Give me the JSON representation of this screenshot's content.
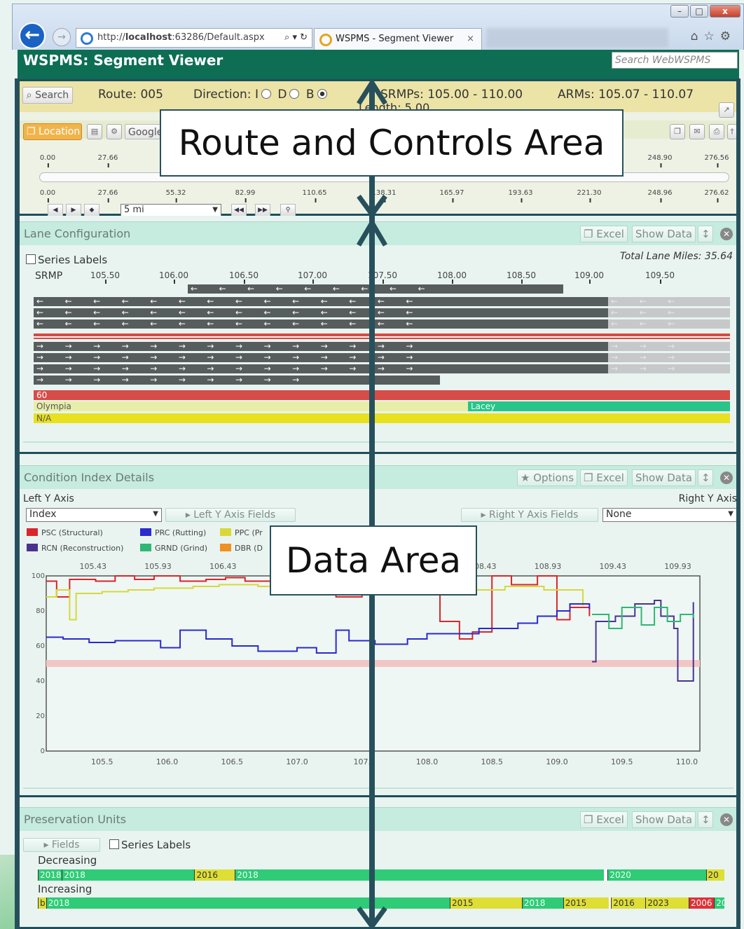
{
  "browser": {
    "url_prefix": "http://",
    "url_host": "localhost",
    "url_rest": ":63286/Default.aspx",
    "address_actions": "⌕ ▾ ↻",
    "tab_title": "WSPMS - Segment Viewer",
    "tab_close": "×",
    "window_min": "–",
    "window_max": "□",
    "window_close": "x",
    "toolbar_icons": "⌂☆⚙"
  },
  "app": {
    "title": "WSPMS: Segment Viewer",
    "search_placeholder": "Search WebWSPMS"
  },
  "route_panel": {
    "search_label": "⌕ Search",
    "route": "Route: 005",
    "direction_label": "Direction:",
    "direction_options": [
      "I",
      "D",
      "B"
    ],
    "direction_selected": "B",
    "srmps": "SRMPs: 105.00 - 110.00",
    "arms": "ARMs: 105.07 - 110.07",
    "length": "Length: 5.00",
    "location_button": "❐ Location",
    "google_button": "Google",
    "upper_scale": [
      "0.00",
      "27.66",
      "248.90",
      "276.56"
    ],
    "lower_scale": [
      "0.00",
      "27.66",
      "55.32",
      "82.99",
      "110.65",
      "138.31",
      "165.97",
      "193.63",
      "221.30",
      "248.96",
      "276.62"
    ],
    "zoom_select": "5 mi"
  },
  "lane_panel": {
    "title": "Lane Configuration",
    "excel": "❐ Excel",
    "show_data": "Show Data",
    "series_labels": "Series Labels",
    "total_lane_miles": "Total Lane Miles: 35.64",
    "srmp_label": "SRMP",
    "srmp_ticks": [
      "105.50",
      "106.00",
      "106.50",
      "107.00",
      "107.50",
      "108.00",
      "108.50",
      "109.00",
      "109.50"
    ],
    "speed_value": "60",
    "city_left": "Olympia",
    "city_right": "Lacey",
    "na_label": "N/A",
    "left_arrow": "←",
    "right_arrow": "→"
  },
  "condition_panel": {
    "title": "Condition Index Details",
    "options": "★ Options",
    "excel": "❐ Excel",
    "show_data": "Show Data",
    "left_axis_label": "Left Y Axis",
    "right_axis_label": "Right Y Axis",
    "left_select": "Index",
    "left_fields": "▸ Left Y Axis Fields",
    "right_fields": "▸ Right Y Axis Fields",
    "right_select": "None",
    "legend": [
      {
        "name": "PSC (Structural)",
        "color": "#d9262a"
      },
      {
        "name": "PRC (Rutting)",
        "color": "#2a2ad0"
      },
      {
        "name": "PPC (Pr",
        "color": "#d8d838"
      },
      {
        "name": "RCN (Reconstruction)",
        "color": "#4a3390"
      },
      {
        "name": "GRND (Grind)",
        "color": "#2fb774"
      },
      {
        "name": "DBR (D",
        "color": "#f09020"
      }
    ]
  },
  "chart_data": {
    "type": "line",
    "top_axis_ticks": [
      "105.43",
      "105.93",
      "106.43",
      "108.43",
      "108.93",
      "109.43",
      "109.93"
    ],
    "x_ticks": [
      "105.5",
      "106.0",
      "106.5",
      "107.0",
      "107.",
      "108.0",
      "108.5",
      "109.0",
      "109.5",
      "110.0"
    ],
    "y_ticks": [
      "100",
      "80",
      "60",
      "40",
      "20",
      "0"
    ],
    "ylim": [
      0,
      100
    ],
    "xlim": [
      105.07,
      110.1
    ],
    "threshold_band": [
      48,
      52
    ],
    "series": [
      {
        "color": "#d9262a",
        "values": [
          [
            105.07,
            97
          ],
          [
            105.15,
            88
          ],
          [
            105.25,
            98
          ],
          [
            105.45,
            97
          ],
          [
            105.6,
            100
          ],
          [
            105.75,
            98
          ],
          [
            105.9,
            100
          ],
          [
            106.1,
            97
          ],
          [
            106.3,
            98
          ],
          [
            106.45,
            99
          ],
          [
            106.6,
            97
          ],
          [
            107.3,
            88
          ],
          [
            107.5,
            92
          ],
          [
            107.62,
            98
          ],
          [
            108.0,
            97
          ],
          [
            108.1,
            74
          ],
          [
            108.25,
            64
          ],
          [
            108.35,
            68
          ],
          [
            108.5,
            100
          ],
          [
            108.65,
            95
          ],
          [
            108.85,
            100
          ],
          [
            109.0,
            75
          ],
          [
            109.1,
            82
          ],
          [
            109.25,
            77
          ]
        ]
      },
      {
        "color": "#d8d838",
        "values": [
          [
            105.07,
            88
          ],
          [
            105.15,
            92
          ],
          [
            105.25,
            75
          ],
          [
            105.3,
            90
          ],
          [
            105.5,
            91
          ],
          [
            105.7,
            92
          ],
          [
            105.9,
            93
          ],
          [
            106.2,
            94
          ],
          [
            106.4,
            95
          ],
          [
            106.7,
            94
          ],
          [
            107.0,
            96
          ],
          [
            107.3,
            93
          ],
          [
            107.6,
            95
          ],
          [
            108.2,
            92
          ],
          [
            108.6,
            94
          ],
          [
            108.9,
            92
          ],
          [
            109.2,
            83
          ]
        ]
      },
      {
        "color": "#2a2ad0",
        "values": [
          [
            105.07,
            65
          ],
          [
            105.2,
            64
          ],
          [
            105.4,
            62
          ],
          [
            105.6,
            63
          ],
          [
            105.95,
            59
          ],
          [
            106.1,
            69
          ],
          [
            106.3,
            64
          ],
          [
            106.5,
            60
          ],
          [
            106.7,
            57
          ],
          [
            107.0,
            59
          ],
          [
            107.15,
            56
          ],
          [
            107.3,
            69
          ],
          [
            107.4,
            63
          ],
          [
            107.6,
            61
          ],
          [
            107.85,
            64
          ],
          [
            108.0,
            67
          ],
          [
            108.4,
            70
          ],
          [
            108.7,
            73
          ],
          [
            108.85,
            77
          ],
          [
            109.0,
            80
          ],
          [
            109.1,
            84
          ],
          [
            109.25,
            81
          ]
        ]
      },
      {
        "color": "#4a3390",
        "values": [
          [
            109.27,
            51
          ],
          [
            109.3,
            74
          ],
          [
            109.45,
            77
          ],
          [
            109.6,
            84
          ],
          [
            109.75,
            86
          ],
          [
            109.8,
            77
          ],
          [
            109.9,
            70
          ],
          [
            109.93,
            40
          ],
          [
            110.05,
            85
          ]
        ]
      },
      {
        "color": "#2fb774",
        "values": [
          [
            109.27,
            78
          ],
          [
            109.4,
            70
          ],
          [
            109.5,
            82
          ],
          [
            109.65,
            72
          ],
          [
            109.75,
            82
          ],
          [
            109.85,
            74
          ],
          [
            109.95,
            78
          ],
          [
            110.05,
            76
          ]
        ]
      }
    ]
  },
  "preservation_panel": {
    "title": "Preservation Units",
    "excel": "❐ Excel",
    "show_data": "Show Data",
    "fields": "▸ Fields",
    "series_labels": "Series Labels",
    "decreasing_label": "Decreasing",
    "increasing_label": "Increasing",
    "decreasing": [
      {
        "label": "2018",
        "start": 0.0,
        "end": 0.035,
        "color": "#2fcb77"
      },
      {
        "label": "2018",
        "start": 0.035,
        "end": 0.228,
        "color": "#2fcb77"
      },
      {
        "label": "2016",
        "start": 0.228,
        "end": 0.287,
        "color": "#dede35"
      },
      {
        "label": "2018",
        "start": 0.287,
        "end": 0.825,
        "color": "#2fcb77"
      },
      {
        "label": "2020",
        "start": 0.83,
        "end": 0.973,
        "color": "#2fcb77"
      },
      {
        "label": "20",
        "start": 0.973,
        "end": 1.0,
        "color": "#dede35"
      }
    ],
    "increasing": [
      {
        "label": "b",
        "start": 0.0,
        "end": 0.012,
        "color": "#dede35"
      },
      {
        "label": "2018",
        "start": 0.012,
        "end": 0.6,
        "color": "#2fcb77"
      },
      {
        "label": "2015",
        "start": 0.6,
        "end": 0.705,
        "color": "#dede35"
      },
      {
        "label": "2018",
        "start": 0.705,
        "end": 0.765,
        "color": "#2fcb77"
      },
      {
        "label": "2015",
        "start": 0.765,
        "end": 0.832,
        "color": "#dede35"
      },
      {
        "label": "2016",
        "start": 0.835,
        "end": 0.885,
        "color": "#dede35"
      },
      {
        "label": "2023",
        "start": 0.885,
        "end": 0.948,
        "color": "#dede35"
      },
      {
        "label": "2006",
        "start": 0.948,
        "end": 0.985,
        "color": "#e0303a"
      },
      {
        "label": "20",
        "start": 0.985,
        "end": 1.0,
        "color": "#2fcb77"
      }
    ]
  },
  "overlay": {
    "route_label": "Route and Controls Area",
    "data_label": "Data Area"
  }
}
